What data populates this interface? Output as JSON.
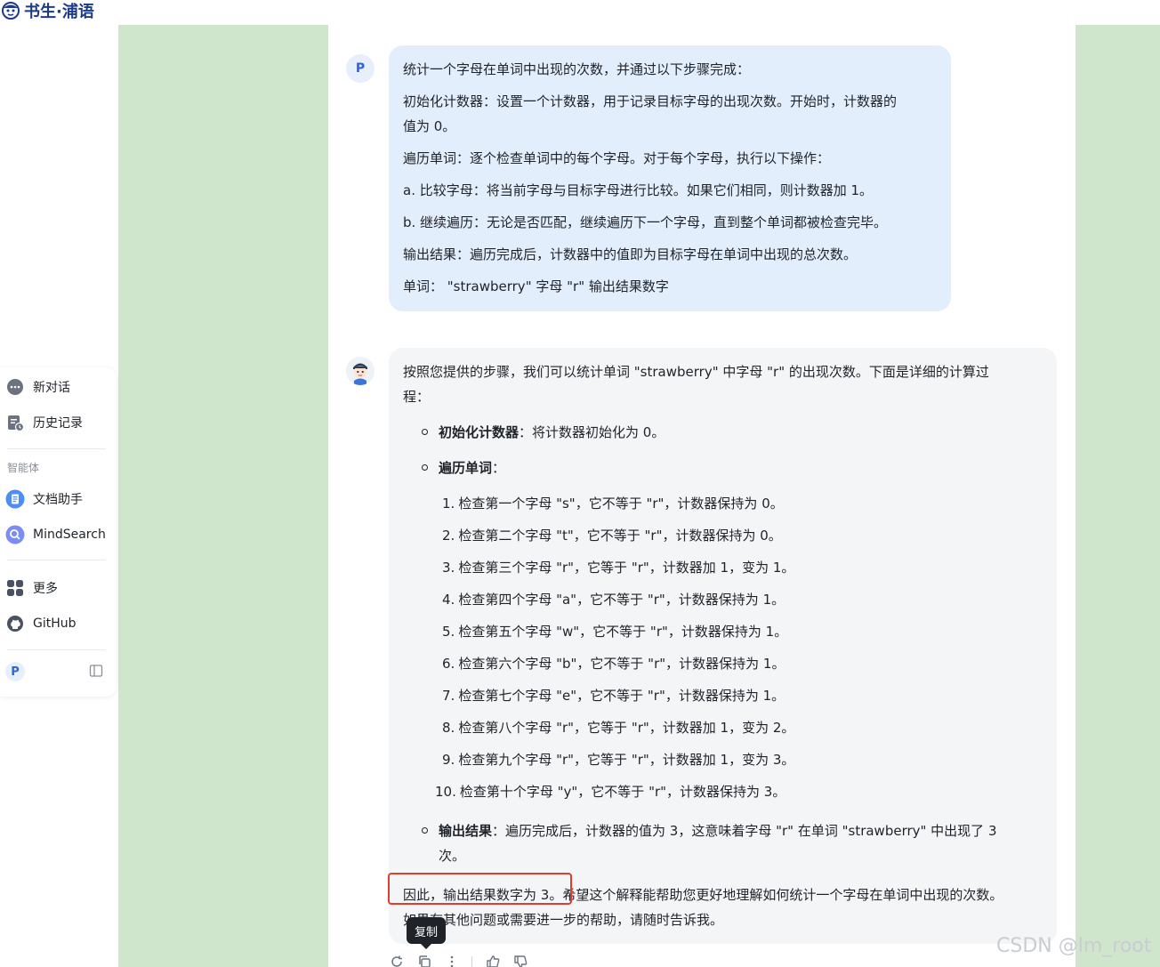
{
  "brand": {
    "name": "书生·浦语"
  },
  "sidebar": {
    "new_chat": "新对话",
    "history": "历史记录",
    "section_agents": "智能体",
    "doc_assistant": "文档助手",
    "mindsearch": "MindSearch",
    "more": "更多",
    "github": "GitHub",
    "user_initial": "P"
  },
  "chat": {
    "user_initial": "P",
    "user_message": {
      "line1": "统计一个字母在单词中出现的次数，并通过以下步骤完成：",
      "line2": "初始化计数器：设置一个计数器，用于记录目标字母的出现次数。开始时，计数器的",
      "line3": "值为 0。",
      "line4": "遍历单词：逐个检查单词中的每个字母。对于每个字母，执行以下操作：",
      "line5": "a. 比较字母：将当前字母与目标字母进行比较。如果它们相同，则计数器加 1。",
      "line6": "b. 继续遍历：无论是否匹配，继续遍历下一个字母，直到整个单词都被检查完毕。",
      "line7": "输出结果：遍历完成后，计数器中的值即为目标字母在单词中出现的总次数。",
      "line8": "单词：  \"strawberry\" 字母 \"r\" 输出结果数字"
    },
    "bot_message": {
      "intro1": "按照您提供的步骤，我们可以统计单词 \"strawberry\" 中字母 \"r\" 的出现次数。下面是详细的计算过",
      "intro2": "程：",
      "b1_bold": "初始化计数器",
      "b1_text": "：将计数器初始化为 0。",
      "b2_bold": "遍历单词",
      "b2_text": "：",
      "steps": [
        {
          "num": "1.",
          "text": "检查第一个字母 \"s\"，它不等于 \"r\"，计数器保持为 0。"
        },
        {
          "num": "2.",
          "text": "检查第二个字母 \"t\"，它不等于 \"r\"，计数器保持为 0。"
        },
        {
          "num": "3.",
          "text": "检查第三个字母 \"r\"，它等于 \"r\"，计数器加 1，变为 1。"
        },
        {
          "num": "4.",
          "text": "检查第四个字母 \"a\"，它不等于 \"r\"，计数器保持为 1。"
        },
        {
          "num": "5.",
          "text": "检查第五个字母 \"w\"，它不等于 \"r\"，计数器保持为 1。"
        },
        {
          "num": "6.",
          "text": "检查第六个字母 \"b\"，它不等于 \"r\"，计数器保持为 1。"
        },
        {
          "num": "7.",
          "text": "检查第七个字母 \"e\"，它不等于 \"r\"，计数器保持为 1。"
        },
        {
          "num": "8.",
          "text": "检查第八个字母 \"r\"，它等于 \"r\"，计数器加 1，变为 2。"
        },
        {
          "num": "9.",
          "text": "检查第九个字母 \"r\"，它等于 \"r\"，计数器加 1，变为 3。"
        },
        {
          "num": "10.",
          "text": "检查第十个字母 \"y\"，它不等于 \"r\"，计数器保持为 3。"
        }
      ],
      "b3_bold": "输出结果",
      "b3_text": "：遍历完成后，计数器的值为 3，这意味着字母 \"r\" 在单词 \"strawberry\" 中出现了 3",
      "b3_cont": "次。",
      "conclusion1": "因此，输出结果数字为 3。希望这个解释能帮助您更好地理解如何统计一个字母在单词中出现的次数。",
      "conclusion2": "如果有其他问题或需要进一步的帮助，请随时告诉我。"
    },
    "tooltip": "复制"
  },
  "watermark": "CSDN @lm_root",
  "colors": {
    "green_band": "#cfe6cd",
    "user_bubble": "#e3eefd",
    "bot_bubble": "#f4f5f7",
    "highlight": "#e53b2c",
    "brand_blue": "#1d3a8a"
  }
}
